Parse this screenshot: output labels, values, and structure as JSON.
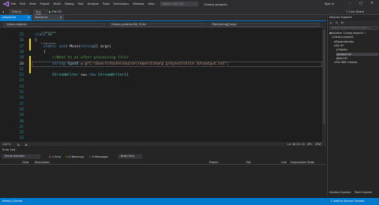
{
  "window": {
    "title": "Csharp projects",
    "search_placeholder": "Search (Ctrl+Q)",
    "sign_in": "Sign in",
    "live_share": "Live Share"
  },
  "menu": [
    "File",
    "Edit",
    "View",
    "Project",
    "Build",
    "Debug",
    "Test",
    "Analyze",
    "Tools",
    "Extensions",
    "Window",
    "Help"
  ],
  "toolbar": {
    "config": "Debug",
    "platform": "Any CPU",
    "start": "File 33"
  },
  "tabs": [
    {
      "label": "output.txt",
      "active": true
    },
    {
      "label": "Source.cs",
      "active": false
    }
  ],
  "nav": {
    "project": "Csharp projects",
    "class": "Csharp_projects.File_33.ex",
    "member": "Main(string[] args)"
  },
  "editor": {
    "lines": [
      {
        "num": "15",
        "refs": "0 references",
        "tokens": [
          [
            "kw",
            "class "
          ],
          [
            "ty",
            "ex"
          ]
        ]
      },
      {
        "num": "16",
        "tokens": [
          [
            "pl",
            "{"
          ]
        ]
      },
      {
        "num": "17",
        "refs": "0 references",
        "tokens": [
          [
            "pl",
            "    "
          ],
          [
            "kw",
            "static void "
          ],
          [
            "pl",
            "Main("
          ],
          [
            "kw",
            "string"
          ],
          [
            "pl",
            "[] args)"
          ]
        ]
      },
      {
        "num": "18",
        "tokens": [
          [
            "pl",
            "    {"
          ]
        ]
      },
      {
        "num": "19",
        "tokens": [
          [
            "pl",
            "        "
          ],
          [
            "cm",
            "//What to an after processing file?"
          ]
        ]
      },
      {
        "num": "20",
        "tokens": [
          [
            "pl",
            "        "
          ],
          [
            "kw",
            "string "
          ],
          [
            "ident",
            "fpath"
          ],
          [
            "pl",
            " = "
          ],
          [
            "st",
            "@\"C:\\Users\\foste\\source\\repos\\Csharp projects\\File 33\\output.txt\""
          ],
          [
            "pl",
            ";"
          ]
        ]
      },
      {
        "num": "21",
        "tokens": [
          [
            "pl",
            ""
          ]
        ]
      },
      {
        "num": "22",
        "tokens": [
          [
            "pl",
            "        "
          ],
          [
            "ty",
            "StreamWriter"
          ],
          [
            "pl",
            " sw= "
          ],
          [
            "kw",
            "new "
          ],
          [
            "ty",
            "StreamWriter"
          ],
          [
            "pl",
            "()"
          ]
        ]
      },
      {
        "num": "23",
        "tokens": [
          [
            "pl",
            ""
          ]
        ]
      },
      {
        "num": "24",
        "tokens": [
          [
            "pl",
            ""
          ]
        ]
      },
      {
        "num": "25",
        "tokens": [
          [
            "pl",
            ""
          ]
        ]
      },
      {
        "num": "26",
        "tokens": [
          [
            "pl",
            ""
          ]
        ]
      },
      {
        "num": "27",
        "tokens": [
          [
            "pl",
            ""
          ]
        ]
      },
      {
        "num": "28",
        "tokens": [
          [
            "pl",
            ""
          ]
        ]
      },
      {
        "num": "29",
        "tokens": [
          [
            "pl",
            ""
          ]
        ]
      },
      {
        "num": "30",
        "tokens": [
          [
            "pl",
            ""
          ]
        ]
      },
      {
        "num": "31",
        "tokens": [
          [
            "pl",
            ""
          ]
        ]
      },
      {
        "num": "32",
        "tokens": [
          [
            "pl",
            ""
          ]
        ]
      },
      {
        "num": "33",
        "tokens": [
          [
            "pl",
            ""
          ]
        ]
      }
    ]
  },
  "editor_status": {
    "zoom": "110 %",
    "errors": "1",
    "warnings": "0",
    "position": "Ln: 16  Ch: 41",
    "spc": "SPC",
    "crlf": "CRLF"
  },
  "error_list": {
    "title": "Error List",
    "scope": "Entire Solution",
    "errors": "1 Error",
    "warnings": "0 Warnings",
    "messages": "0 Messages",
    "build": "Build Only",
    "columns": [
      "Code",
      "Description",
      "Project",
      "File",
      "Line",
      "Suppression State"
    ]
  },
  "solution_explorer": {
    "title": "Solution Explorer",
    "search_placeholder": "Search Solution Explorer (Ctrl+;)",
    "items": [
      {
        "label": "Solution 'Csharp projects' (",
        "indent": 0
      },
      {
        "label": "Csharp projects",
        "indent": 1
      },
      {
        "label": "Dependencies",
        "indent": 2
      },
      {
        "label": "File 33",
        "indent": 2
      },
      {
        "label": "Classes",
        "indent": 3
      },
      {
        "label": "output.txt",
        "indent": 3,
        "selected": true
      },
      {
        "label": "sec.txt",
        "indent": 3
      },
      {
        "label": "Fun With Classes",
        "indent": 2
      }
    ],
    "bottom_tabs": [
      "Solution Explorer",
      "Team Explorer"
    ]
  },
  "status": {
    "ready": "Item(s) Saved",
    "add_sc": "Add to Source Control"
  }
}
